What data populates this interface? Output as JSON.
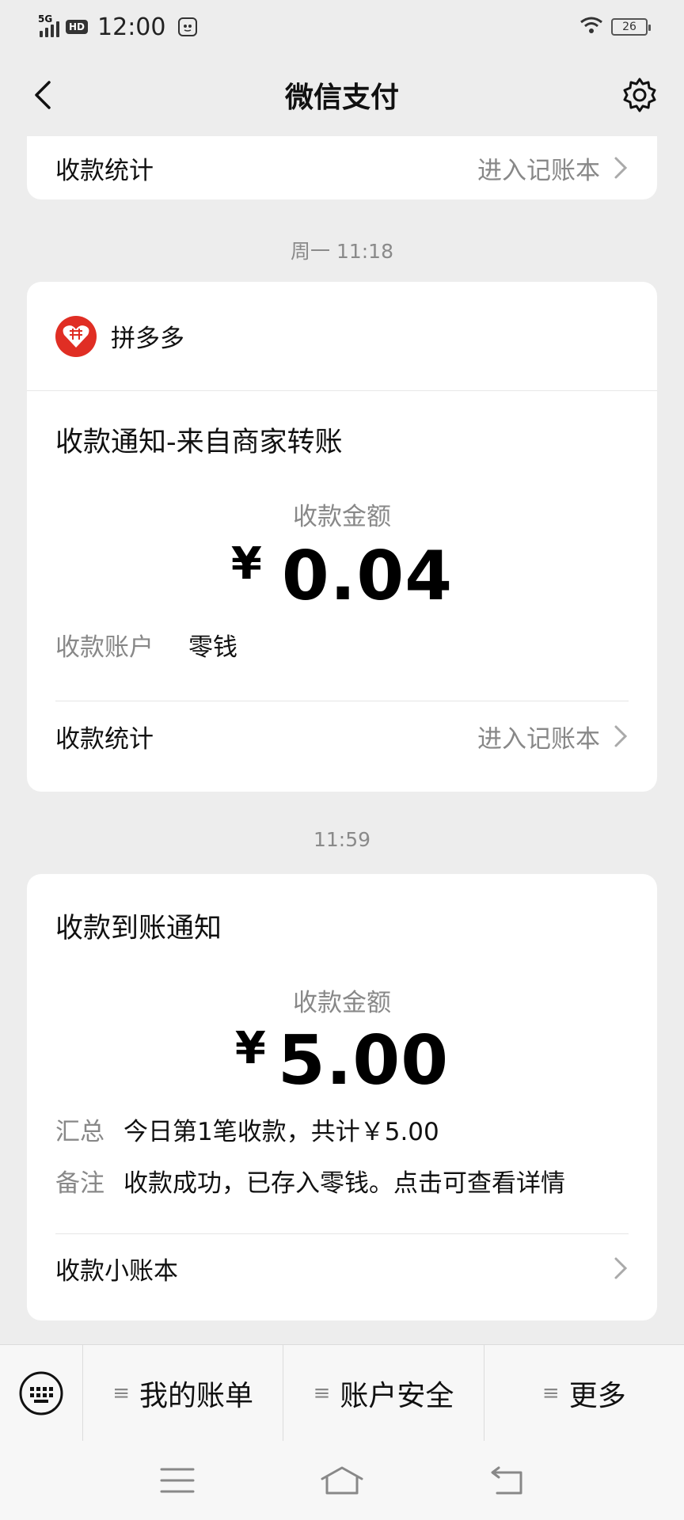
{
  "status_bar": {
    "network": "5G",
    "hd": "HD",
    "time": "12:00",
    "battery": "26"
  },
  "header": {
    "title": "微信支付",
    "icons": [
      "back-icon",
      "settings-icon"
    ]
  },
  "top_card": {
    "label": "收款统计",
    "link": "进入记账本"
  },
  "msg1": {
    "timestamp": "周一 11:18",
    "merchant": "拼多多",
    "title": "收款通知-来自商家转账",
    "amount_label": "收款金额",
    "currency": "¥",
    "amount": "0.04",
    "account_key": "收款账户",
    "account_value": "零钱",
    "stats_label": "收款统计",
    "stats_link": "进入记账本"
  },
  "msg2": {
    "timestamp": "11:59",
    "title": "收款到账通知",
    "amount_label": "收款金额",
    "currency": "¥",
    "amount": "5.00",
    "summary_key": "汇总",
    "summary_value": "今日第1笔收款，共计￥5.00",
    "note_key": "备注",
    "note_value": "收款成功，已存入零钱。点击可查看详情",
    "ledger_label": "收款小账本"
  },
  "bottom_menu": {
    "items": [
      {
        "label": "我的账单"
      },
      {
        "label": "账户安全"
      },
      {
        "label": "更多"
      }
    ]
  },
  "colors": {
    "background": "#ededed",
    "card": "#ffffff",
    "merchant_logo": "#e02e24",
    "secondary_text": "#888888"
  }
}
